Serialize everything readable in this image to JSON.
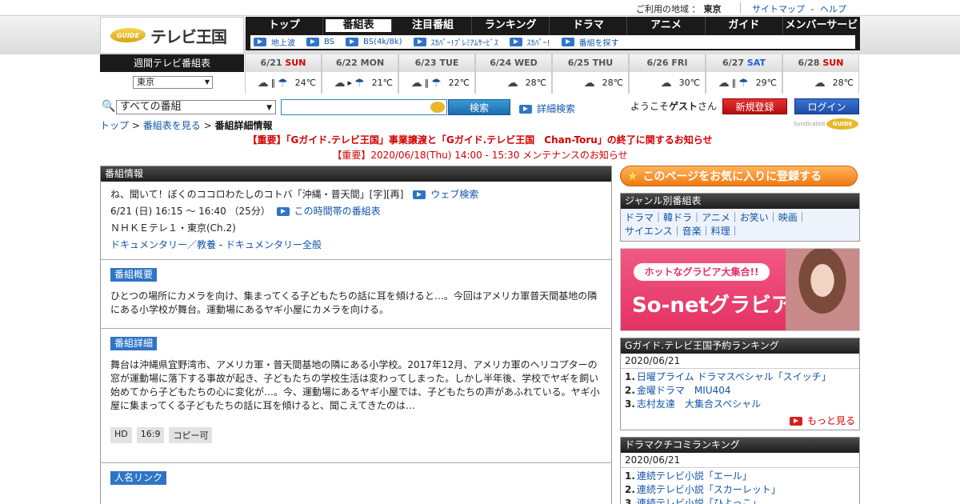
{
  "util": {
    "area_label": "ご利用の地域 ：",
    "area_value": "東京",
    "sitemap": "サイトマップ",
    "dash": "-",
    "help": "ヘルプ"
  },
  "logo": {
    "mark": "GUIDE",
    "text": "テレビ王国"
  },
  "nav": {
    "tabs": [
      "トップ",
      "番組表",
      "注目番組",
      "ランキング",
      "ドラマ",
      "アニメ",
      "ガイド",
      "メンバーサービス"
    ],
    "sub": [
      "地上波",
      "BS",
      "BS(4k/8k)",
      "ｽｶﾊﾟｰ!ﾌﾟﾚﾐｱﾑｻｰﾋﾞｽ",
      "ｽｶﾊﾟｰ!",
      "番組を探す"
    ]
  },
  "weekly": {
    "label": "週間テレビ番組表",
    "region": "東京",
    "days": [
      {
        "date": "6/21",
        "dow": "SUN",
        "kind": "sun",
        "w1": "☁",
        "sep": "‖",
        "w2": "☂",
        "temp": "24℃"
      },
      {
        "date": "6/22",
        "dow": "MON",
        "kind": "",
        "w1": "☁",
        "sep": "▸",
        "w2": "☂",
        "temp": "21℃"
      },
      {
        "date": "6/23",
        "dow": "TUE",
        "kind": "",
        "w1": "☁",
        "sep": "‖",
        "w2": "☂",
        "temp": "22℃"
      },
      {
        "date": "6/24",
        "dow": "WED",
        "kind": "",
        "w1": "☁",
        "sep": "",
        "w2": "",
        "temp": "28℃"
      },
      {
        "date": "6/25",
        "dow": "THU",
        "kind": "",
        "w1": "☁",
        "sep": "",
        "w2": "",
        "temp": "28℃"
      },
      {
        "date": "6/26",
        "dow": "FRI",
        "kind": "",
        "w1": "☁",
        "sep": "",
        "w2": "",
        "temp": "30℃"
      },
      {
        "date": "6/27",
        "dow": "SAT",
        "kind": "sat",
        "w1": "☁",
        "sep": "‖",
        "w2": "☂",
        "temp": "29℃"
      },
      {
        "date": "6/28",
        "dow": "SUN",
        "kind": "sun",
        "w1": "☁",
        "sep": "",
        "w2": "",
        "temp": "28℃"
      }
    ]
  },
  "search": {
    "category": "すべての番組",
    "button": "検索",
    "advanced": "詳細検索"
  },
  "account": {
    "welcome_pre": "ようこそ",
    "guest": "ゲスト",
    "welcome_post": "さん",
    "register": "新規登録",
    "login": "ログイン"
  },
  "breadcrumb": {
    "top": "トップ",
    "sep": ">",
    "schedule": "番組表を見る",
    "current": "番組詳細情報"
  },
  "syndicated": {
    "label": "Syndicated",
    "mark": "GUIDE"
  },
  "notices": {
    "n1": "【重要】「Gガイド.テレビ王国」事業譲渡と「Gガイド.テレビ王国　Chan-Toru」の終了に関するお知らせ",
    "n2": "【重要】2020/06/18(Thu) 14:00 - 15:30 メンテナンスのお知らせ"
  },
  "program": {
    "header": "番組情報",
    "title": "ね、聞いて！ぼくのココロわたしのコトバ「沖縄・普天間」[字][再]",
    "web_search": "ウェブ検索",
    "time": "6/21 (日) 16:15 ～ 16:40 （25分）",
    "time_link": "この時間帯の番組表",
    "channel": "ＮＨＫＥテレ１・東京(Ch.2)",
    "genre1": "ドキュメンタリー／教養",
    "genre_sep": "-",
    "genre2": "ドキュメンタリー全般",
    "summary_label": "番組概要",
    "summary": "ひとつの場所にカメラを向け、集まってくる子どもたちの話に耳を傾けると…。今回はアメリカ軍普天間基地の隣にある小学校が舞台。運動場にあるヤギ小屋にカメラを向ける。",
    "detail_label": "番組詳細",
    "detail": "舞台は沖縄県宜野湾市、アメリカ軍・普天間基地の隣にある小学校。2017年12月、アメリカ軍のヘリコプターの窓が運動場に落下する事故が起き、子どもたちの学校生活は変わってしまった。しかし半年後、学校でヤギを飼い始めてから子どもたちの心に変化が…。今、運動場にあるヤギ小屋では、子どもたちの声があふれている。ヤギ小屋に集まってくる子どもたちの話に耳を傾けると、聞こえてきたのは…",
    "badges": [
      "HD",
      "16:9",
      "コピー可"
    ],
    "people_label": "人名リンク"
  },
  "side": {
    "favorite": "このページをお気に入りに登録する",
    "genre_header": "ジャンル別番組表",
    "genres_line1": "ドラマ｜韓ドラ｜アニメ｜お笑い｜映画｜",
    "genres_line2": "サイエンス｜音楽｜料理｜",
    "banner_pill": "ホットなグラビア大集合!!",
    "banner_big": "So-netグラビア",
    "rank1_header": "Gガイド.テレビ王国予約ランキング",
    "rank1_date": "2020/06/21",
    "rank1": [
      {
        "n": "1.",
        "t": "日曜プライム ドラマスペシャル「スイッチ」"
      },
      {
        "n": "2.",
        "t": "金曜ドラマ　MIU404"
      },
      {
        "n": "3.",
        "t": "志村友達　大集合スペシャル"
      }
    ],
    "more": "もっと見る",
    "rank2_header": "ドラマクチコミランキング",
    "rank2_date": "2020/06/21",
    "rank2": [
      {
        "n": "1.",
        "t": "連続テレビ小説「エール」"
      },
      {
        "n": "2.",
        "t": "連続テレビ小説「スカーレット」"
      },
      {
        "n": "3.",
        "t": "連続テレビ小説「ひよっこ」"
      }
    ]
  }
}
